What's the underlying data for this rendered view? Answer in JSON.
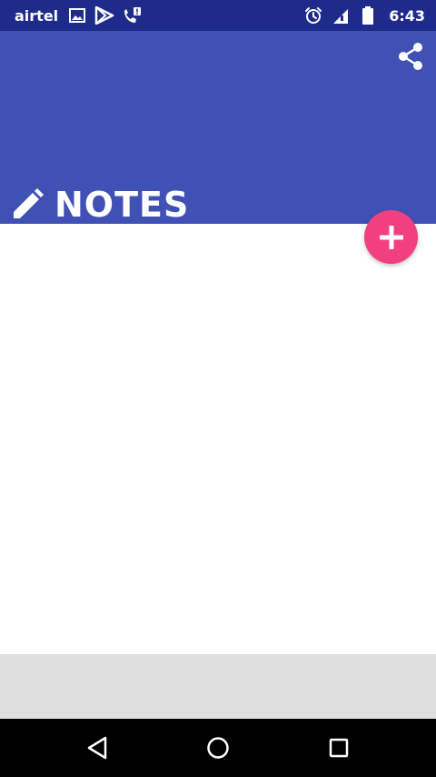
{
  "status_bar": {
    "carrier": "airtel",
    "time": "6:43",
    "icons_left": [
      "image-icon",
      "play-store-icon",
      "phone-alert-icon"
    ],
    "icons_right": [
      "alarm-icon",
      "signal-icon",
      "battery-icon"
    ]
  },
  "app_bar": {
    "title": "NOTES",
    "title_icon": "pencil-icon",
    "action_icon": "share-icon"
  },
  "fab": {
    "icon": "plus-icon"
  },
  "nav_bar": {
    "buttons": [
      "back-icon",
      "home-icon",
      "recents-icon"
    ]
  },
  "colors": {
    "status_bar": "#1f2b8a",
    "app_bar": "#3f51b5",
    "fab": "#f2407e",
    "bottom_strip": "#dfdfdf",
    "nav_bar": "#000000"
  }
}
